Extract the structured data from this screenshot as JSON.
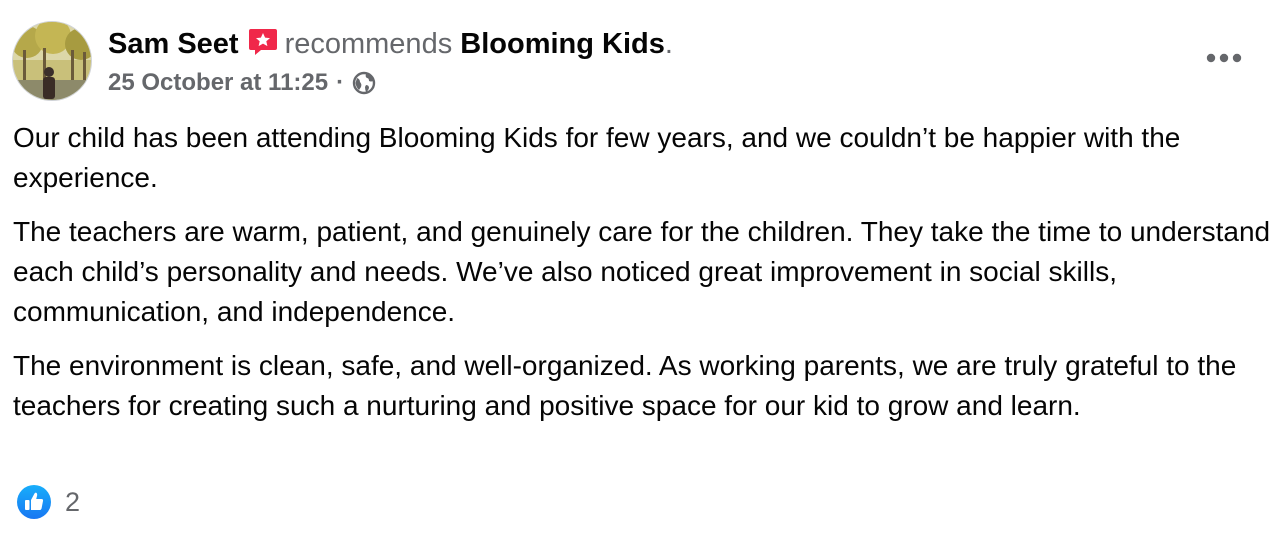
{
  "post": {
    "author": "Sam Seet",
    "action": "recommends",
    "page_name": "Blooming Kids",
    "page_suffix": ".",
    "timestamp": "25 October at 11:25",
    "separator": "·",
    "privacy_icon": "globe-icon",
    "recommend_icon": "recommend-star-icon",
    "more_icon": "more-options-icon",
    "paragraphs": [
      "Our child has been attending Blooming Kids for few years, and we couldn’t be happier with the experience.",
      "The teachers are warm, patient, and genuinely care for the children. They take the time to understand each child’s personality and needs. We’ve also noticed great improvement in social skills, communication, and independence.",
      "The environment is clean, safe, and well-organized. As working parents, we are truly grateful to the teachers for creating such a nurturing and positive space for our kid to grow and learn."
    ],
    "reactions": {
      "icon": "like-icon",
      "count": "2"
    }
  },
  "colors": {
    "text": "#050505",
    "muted": "#65676b",
    "recommend_red": "#f0284a",
    "like_blue": "#1877f2"
  }
}
